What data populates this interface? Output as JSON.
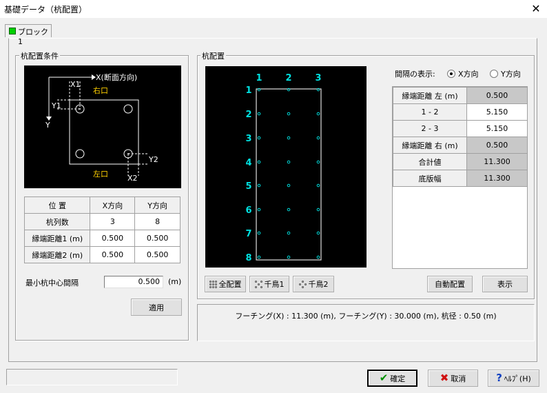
{
  "window": {
    "title": "基礎データ（杭配置）",
    "close_glyph": "✕"
  },
  "tab": {
    "label": "ブロック1"
  },
  "left_group": {
    "title": "杭配置条件",
    "diagram": {
      "axis_x": "X(断面方向)",
      "axis_y": "Y",
      "x1": "X1",
      "y1": "Y1",
      "x2": "X2",
      "y2": "Y2",
      "right_label": "右口",
      "left_label": "左口"
    },
    "table": {
      "headers": [
        "位 置",
        "X方向",
        "Y方向"
      ],
      "rows": [
        [
          "杭列数",
          "3",
          "8"
        ],
        [
          "縁端距離1 (m)",
          "0.500",
          "0.500"
        ],
        [
          "縁端距離2 (m)",
          "0.500",
          "0.500"
        ]
      ]
    },
    "min_spacing": {
      "label": "最小杭中心間隔",
      "value": "0.500",
      "unit": "(m)"
    },
    "apply_button": "適用"
  },
  "right_group": {
    "title": "杭配置",
    "plot": {
      "col_labels": [
        "1",
        "2",
        "3"
      ],
      "row_labels": [
        "1",
        "2",
        "3",
        "4",
        "5",
        "6",
        "7",
        "8"
      ],
      "columns": 3,
      "rows": 8
    },
    "spacing_display": {
      "label": "間隔の表示:",
      "options": [
        "X方向",
        "Y方向"
      ],
      "selected": "X方向"
    },
    "spacing_table": [
      [
        "縁端距離 左 (m)",
        "0.500"
      ],
      [
        "1 - 2",
        "5.150"
      ],
      [
        "2 - 3",
        "5.150"
      ],
      [
        "縁端距離 右 (m)",
        "0.500"
      ],
      [
        "合計値",
        "11.300"
      ],
      [
        "底版幅",
        "11.300"
      ]
    ],
    "buttons": {
      "all": "全配置",
      "zigzag1": "千鳥1",
      "zigzag2": "千鳥2",
      "auto": "自動配置",
      "show": "表示"
    }
  },
  "info_text": "フーチング(X) : 11.300 (m), フーチング(Y) : 30.000 (m), 杭径 : 0.50 (m)",
  "footer": {
    "ok": "確定",
    "cancel": "取消",
    "help": "ﾍﾙﾌﾟ(H)"
  },
  "colors": {
    "plot_bg": "#000000",
    "plot_labels": "#00e0e0",
    "diagram_lines": "#ffffff",
    "diagram_yellow": "#ffd000",
    "pile_dot": "#00d8d8",
    "footing_outline": "#e0e0e0",
    "tab_chip": "#00d000",
    "ok_check": "#009000",
    "cancel_x": "#d01010",
    "help_q": "#1040c0"
  }
}
